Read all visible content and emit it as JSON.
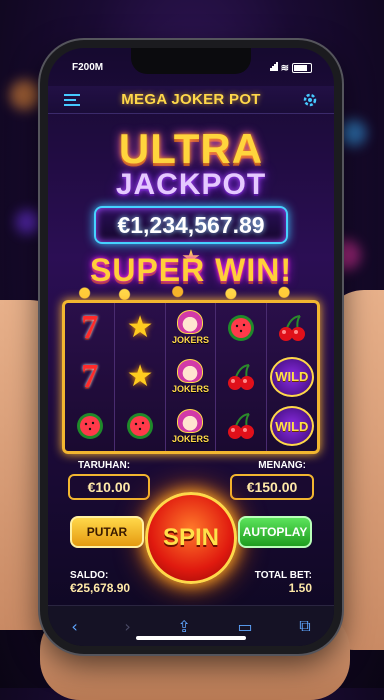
{
  "status_bar": {
    "carrier": "F200M"
  },
  "header": {
    "title": "MEGA JOKER POT",
    "menu_icon": "menu-icon",
    "settings_icon": "gear-icon"
  },
  "jackpot": {
    "line1": "ULTRA",
    "line2": "JACKPOT",
    "amount": "€1,234,567.89"
  },
  "banner": {
    "text": "SUPER WIN!"
  },
  "reels": {
    "rows": [
      [
        "7",
        "star",
        "JOKERS",
        "watermelon",
        "cherries"
      ],
      [
        "7",
        "star",
        "JOKERS",
        "cherries",
        "WILD"
      ],
      [
        "watermelon",
        "watermelon",
        "JOKERS",
        "cherries",
        "WILD"
      ]
    ]
  },
  "controls": {
    "bet_label": "TARUHAN:",
    "bet_value": "€10.00",
    "win_label": "MENANG:",
    "win_value": "€150.00",
    "spin_label": "SPIN",
    "putar_label": "PUTAR",
    "autoplay_label": "AUTOPLAY"
  },
  "footer": {
    "balance_label": "SALDO:",
    "balance_value": "€25,678.90",
    "total_bet_label": "TOTAL BET:",
    "total_bet_value": "1.50"
  },
  "browser": {
    "icons": [
      "back-icon",
      "forward-icon",
      "share-icon",
      "bookmarks-icon",
      "tabs-icon"
    ]
  },
  "colors": {
    "accent_gold": "#ffd84a",
    "accent_cyan": "#46d2ff",
    "accent_purple": "#a44bff"
  }
}
